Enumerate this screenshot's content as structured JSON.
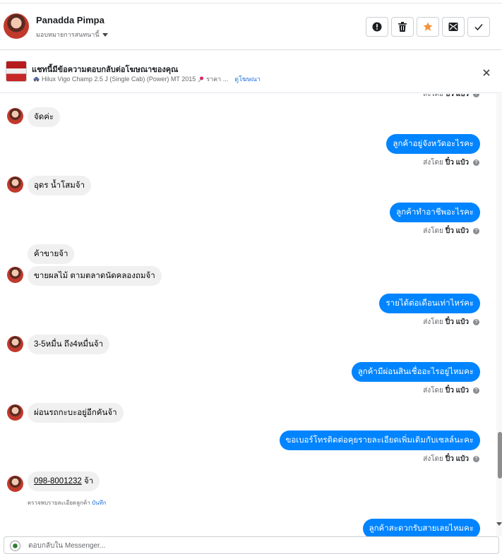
{
  "header": {
    "name": "Panadda Pimpa",
    "assign_label": "มอบหมายการสนทนานี้"
  },
  "ad": {
    "title": "แชทนี้มีข้อความตอบกลับต่อโฆษณาของคุณ",
    "car": "Hilux Vigo Champ 2.5 J (Single Cab) (Power) MT 2015",
    "price": "ราคา ...",
    "link": "ดูโฆษณา"
  },
  "sent_by": {
    "prefix": "ส่งโดย",
    "name": "ปิ๋ว แป๋ว"
  },
  "messages": [
    {
      "dir": "in",
      "text": "จัดค่ะ"
    },
    {
      "dir": "out",
      "text": "ลูกค้าอยู่จังหวัดอะไรคะ"
    },
    {
      "dir": "in",
      "text": "อุดร น้ำโสมจ้า"
    },
    {
      "dir": "out",
      "text": "ลูกค้าทำอาชีพอะไรคะ"
    },
    {
      "dir": "in",
      "text": "ค้าขายจ้า"
    },
    {
      "dir": "in",
      "text": "ขายผลไม้ ตามตลาดนัดคลองถมจ้า"
    },
    {
      "dir": "out",
      "text": "รายได้ต่อเดือนเท่าไหร่คะ"
    },
    {
      "dir": "in",
      "text": "3-5หมื่น ถึง4หมื่นจ้า"
    },
    {
      "dir": "out",
      "text": "ลูกค้ามีผ่อนสินเชื่ออะไรอยู่ไหมคะ"
    },
    {
      "dir": "in",
      "text": "ผ่อนรถกะบะอยู่อีกคันจ้า"
    },
    {
      "dir": "out",
      "text": "ขอเบอร์โทรติดต่อคุยรายละเอียดเพิ่มเติมกับเซลล์นะคะ"
    },
    {
      "dir": "in",
      "phone": "098-8001232",
      "suffix": " จ้า"
    },
    {
      "dir": "out",
      "text": "ลูกค้าสะดวกรับสายเลยไหมคะ"
    }
  ],
  "phone_note": {
    "text": "ตรวจพบรายละเอียดลูกค้า",
    "link": "บันทึก"
  },
  "composer": {
    "placeholder": "ตอบกลับใน Messenger..."
  },
  "colors": {
    "outgoing_bubble": "#0084ff",
    "incoming_bubble": "#f0f0f0",
    "star": "#f7923b",
    "link": "#216fdb"
  },
  "icons": [
    "alert-icon",
    "trash-icon",
    "star-icon",
    "mark-unread-icon",
    "check-icon",
    "close-icon",
    "car-icon",
    "pin-icon",
    "help-icon"
  ]
}
